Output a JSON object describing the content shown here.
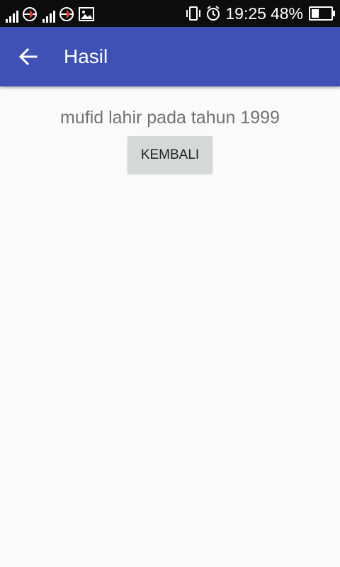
{
  "status_bar": {
    "time": "19:25",
    "battery_percent": "48%",
    "battery_level": 0.48,
    "icons": [
      "signal-icon",
      "carrier-icon",
      "signal-icon",
      "carrier-icon",
      "image-icon",
      "vibrate-icon",
      "alarm-icon",
      "battery-icon"
    ]
  },
  "app_bar": {
    "title": "Hasil",
    "back_icon": "arrow-left-icon",
    "color": "#3f51b5"
  },
  "main": {
    "result_text": "mufid lahir pada tahun 1999",
    "button_label": "KEMBALI"
  }
}
